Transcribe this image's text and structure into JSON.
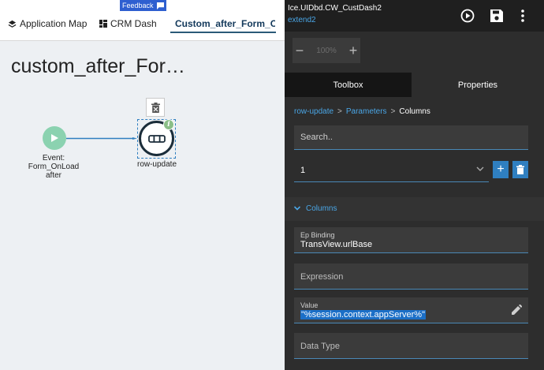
{
  "tabs": [
    {
      "label": "Application Map",
      "icon": "layers-icon"
    },
    {
      "label": "CRM Dash",
      "icon": "dashboard-icon"
    },
    {
      "label": "Custom_after_Form_OnL",
      "icon": "flow-icon"
    }
  ],
  "feedback_label": "Feedback",
  "canvas": {
    "title": "custom_after_For…",
    "event_node_label": "Event:\nForm_OnLoad\nafter",
    "action_node_label": "row-update",
    "info_badge": "i"
  },
  "header": {
    "title": "Ice.UIDbd.CW_CustDash2",
    "subtitle": "extend2"
  },
  "zoom": {
    "minus": "−",
    "value": "100%",
    "plus": "+"
  },
  "panel_tabs": {
    "toolbox": "Toolbox",
    "properties": "Properties",
    "active": "Toolbox"
  },
  "breadcrumb": {
    "items": [
      "row-update",
      "Parameters",
      "Columns"
    ],
    "separator": ">"
  },
  "search": {
    "placeholder": "Search.."
  },
  "row_selector": {
    "value": "1",
    "add_label": "+"
  },
  "columns_section": {
    "label": "Columns"
  },
  "fields": {
    "ep_binding": {
      "label": "Ep Binding",
      "value": "TransView.urlBase"
    },
    "expression": {
      "placeholder": "Expression"
    },
    "value": {
      "label": "Value",
      "value": "\"%session.context.appServer%\""
    },
    "data_type": {
      "placeholder": "Data Type"
    }
  },
  "colors": {
    "accent_blue": "#4aa6e6",
    "button_blue": "#2f7fc0",
    "event_node": "#8bd2b0",
    "dark_panel": "#2d2d2d"
  }
}
